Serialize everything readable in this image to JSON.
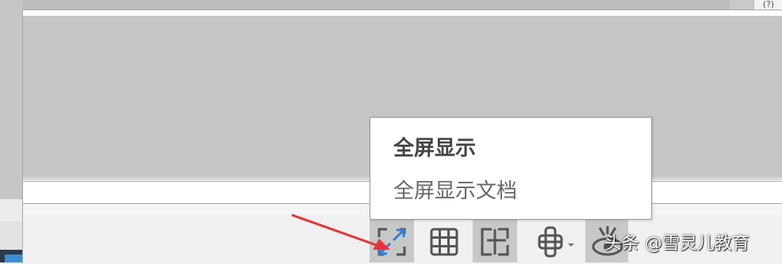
{
  "header": {
    "help_label": "(?)"
  },
  "context_menu": {
    "items": [
      {
        "label": "全屏显示"
      },
      {
        "label": "全屏显示文档"
      }
    ]
  },
  "toolbar": {
    "buttons": [
      {
        "icon": "fullscreen-icon",
        "active": true
      },
      {
        "icon": "grid-icon",
        "active": false
      },
      {
        "icon": "fit-page-icon",
        "active": true
      },
      {
        "icon": "move-dropdown-icon",
        "active": false
      },
      {
        "icon": "eye-icon",
        "active": true
      }
    ]
  },
  "watermark": {
    "text": "头条 @雪灵儿教育"
  },
  "colors": {
    "gray_area": "#c6c4c6",
    "active_button": "#c8c8c8",
    "icon_blue": "#2f7fd6",
    "icon_dark": "#555555",
    "arrow_red": "#e8333a"
  }
}
